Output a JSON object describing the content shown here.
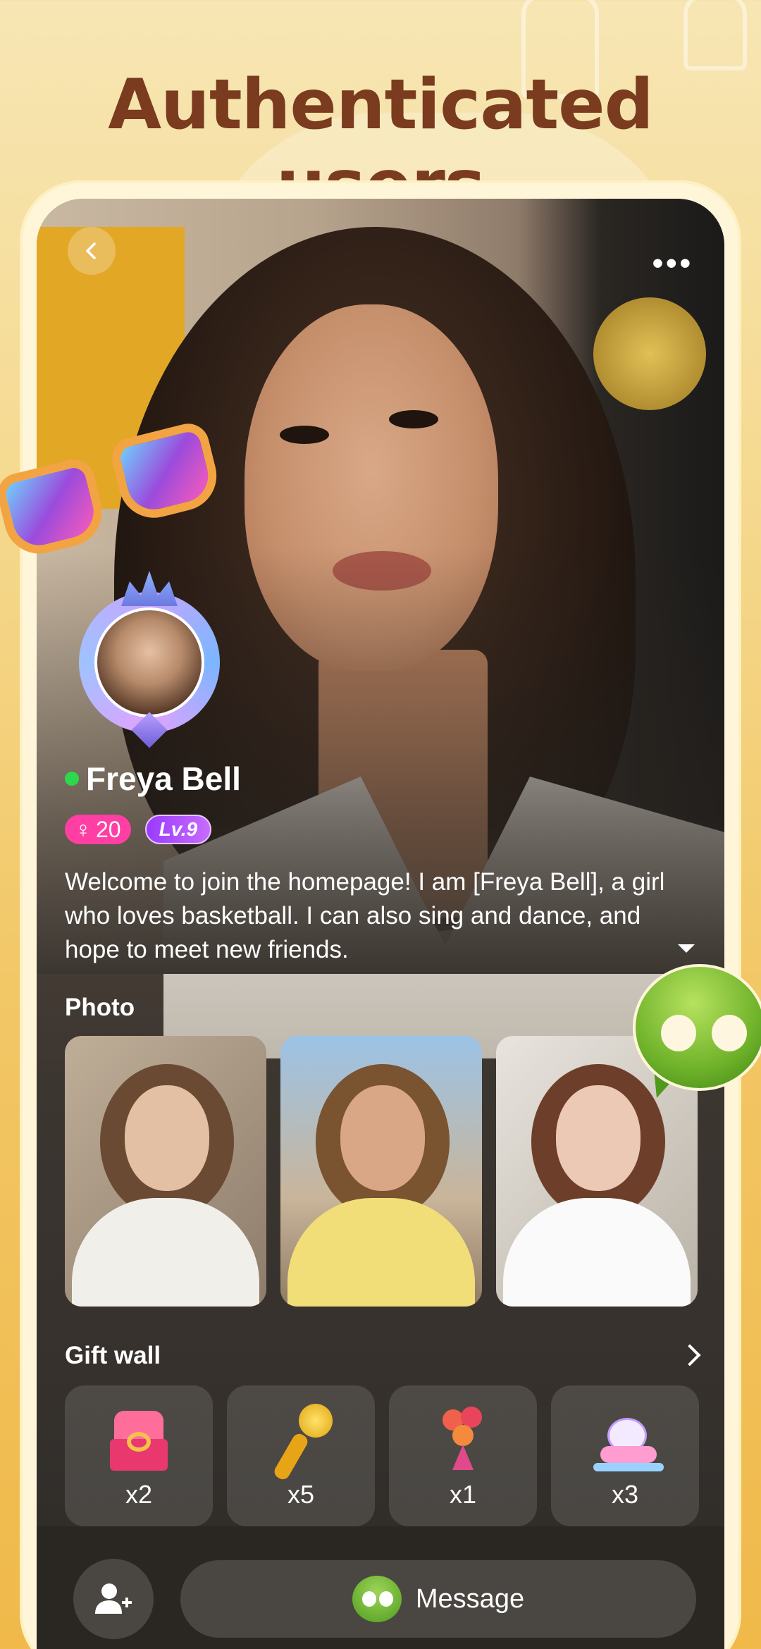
{
  "headline": "Authenticated users",
  "profile": {
    "name": "Freya Bell",
    "online": true,
    "gender_symbol": "♀",
    "age": "20",
    "level": "Lv.9",
    "bio": "Welcome to join the homepage! I am [Freya Bell], a girl who loves basketball. I can also sing and dance, and hope to meet new friends."
  },
  "sections": {
    "photo_title": "Photo",
    "gift_wall_title": "Gift wall"
  },
  "photos": [
    {
      "desc": "photo-1"
    },
    {
      "desc": "photo-2"
    },
    {
      "desc": "photo-3"
    }
  ],
  "gifts": [
    {
      "icon": "ring-box-icon",
      "count": "x2"
    },
    {
      "icon": "microphone-icon",
      "count": "x5"
    },
    {
      "icon": "bouquet-icon",
      "count": "x1"
    },
    {
      "icon": "unicorn-rocker-icon",
      "count": "x3"
    }
  ],
  "actions": {
    "message_label": "Message"
  },
  "colors": {
    "headline": "#7a3b1f",
    "online": "#2bd94a",
    "gender_badge": "#ff3fa3",
    "level_badge": "#9a3bff",
    "chat_green": "#6fb22a"
  }
}
